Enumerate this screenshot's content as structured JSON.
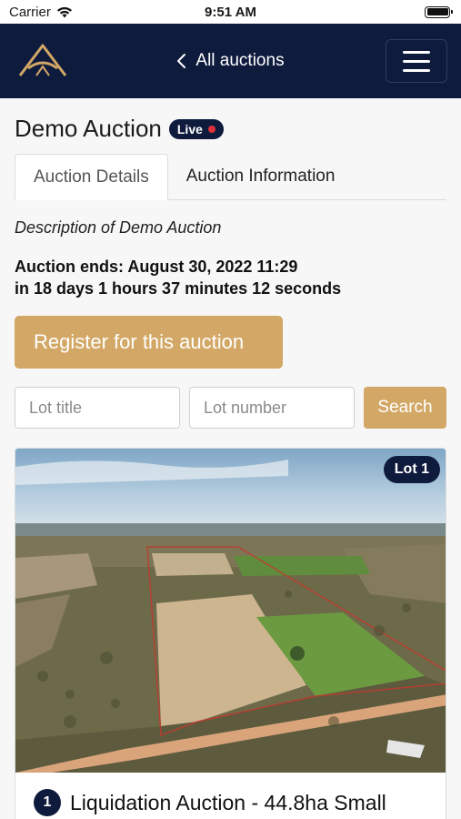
{
  "status_bar": {
    "carrier": "Carrier",
    "time": "9:51 AM"
  },
  "header": {
    "back_label": "All auctions",
    "icons": [
      "logo-icon",
      "chevron-left-icon",
      "hamburger-menu-icon"
    ]
  },
  "auction": {
    "title": "Demo Auction",
    "live_label": "Live",
    "tabs": [
      {
        "label": "Auction Details",
        "active": true
      },
      {
        "label": "Auction Information",
        "active": false
      }
    ],
    "description": "Description of Demo Auction",
    "ends_line": "Auction ends: August 30, 2022 11:29",
    "countdown_line": "in 18 days 1 hours 37 minutes 12 seconds",
    "register_label": "Register for this auction"
  },
  "search": {
    "lot_title_placeholder": "Lot title",
    "lot_number_placeholder": "Lot number",
    "button_label": "Search"
  },
  "lot": {
    "badge": "Lot 1",
    "number": "1",
    "title": "Liquidation Auction - 44.8ha Small"
  },
  "colors": {
    "navy": "#0f1b3d",
    "gold": "#d3a866",
    "live_dot": "#e0313a"
  }
}
